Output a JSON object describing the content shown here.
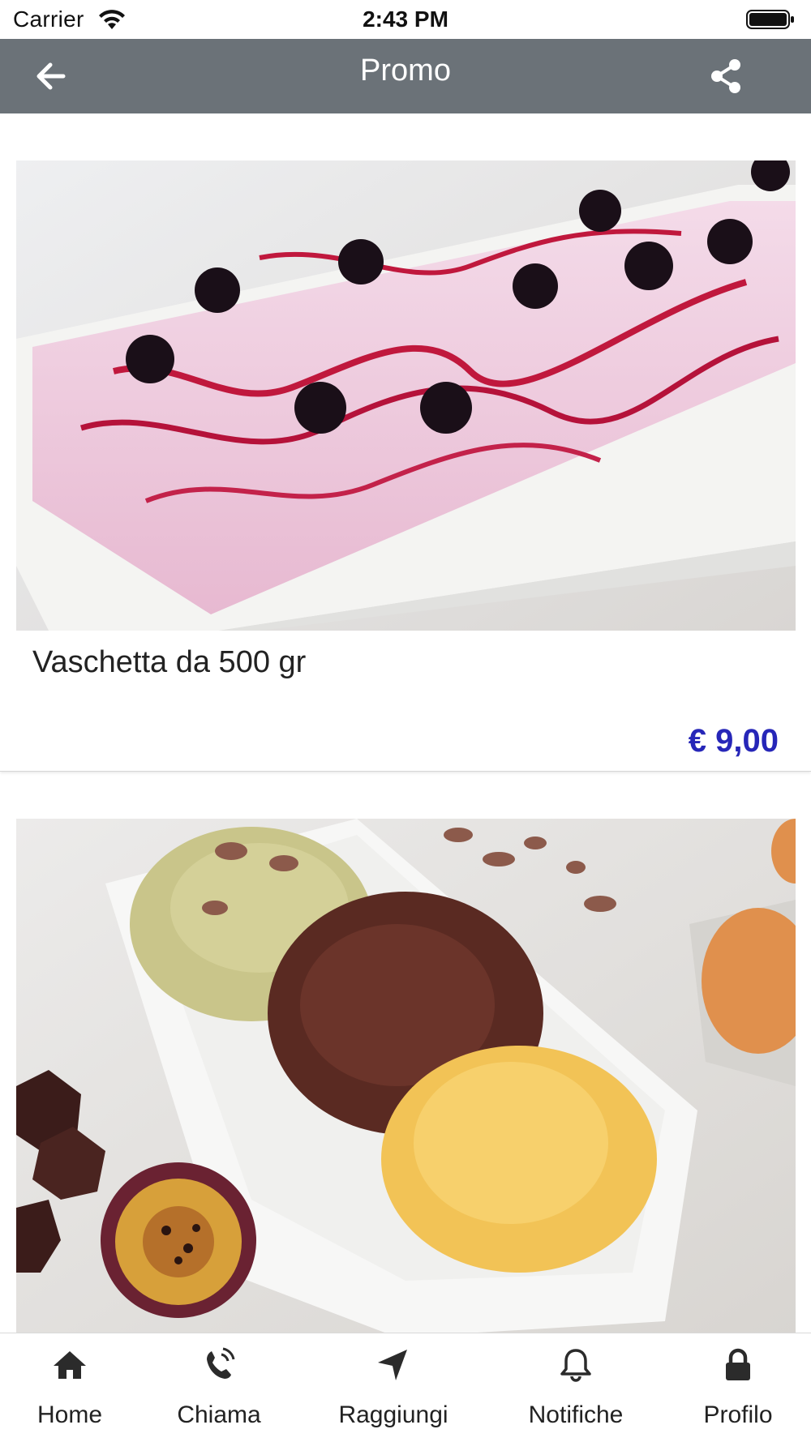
{
  "status_bar": {
    "carrier": "Carrier",
    "time": "2:43 PM"
  },
  "header": {
    "title": "Promo",
    "background": "#6b7278",
    "back_icon": "arrow-left-icon",
    "share_icon": "share-icon"
  },
  "promos": [
    {
      "title": "Vaschetta da 500 gr",
      "price": "€ 9,00",
      "image": "ice-cream-tub-berries-photo"
    },
    {
      "image": "ice-cream-tub-pistachio-chocolate-mango-photo"
    }
  ],
  "colors": {
    "price": "#2626b8"
  },
  "tab_bar": {
    "items": [
      {
        "label": "Home",
        "icon": "home-icon"
      },
      {
        "label": "Chiama",
        "icon": "phone-icon"
      },
      {
        "label": "Raggiungi",
        "icon": "location-arrow-icon"
      },
      {
        "label": "Notifiche",
        "icon": "bell-icon"
      },
      {
        "label": "Profilo",
        "icon": "lock-icon"
      }
    ]
  }
}
